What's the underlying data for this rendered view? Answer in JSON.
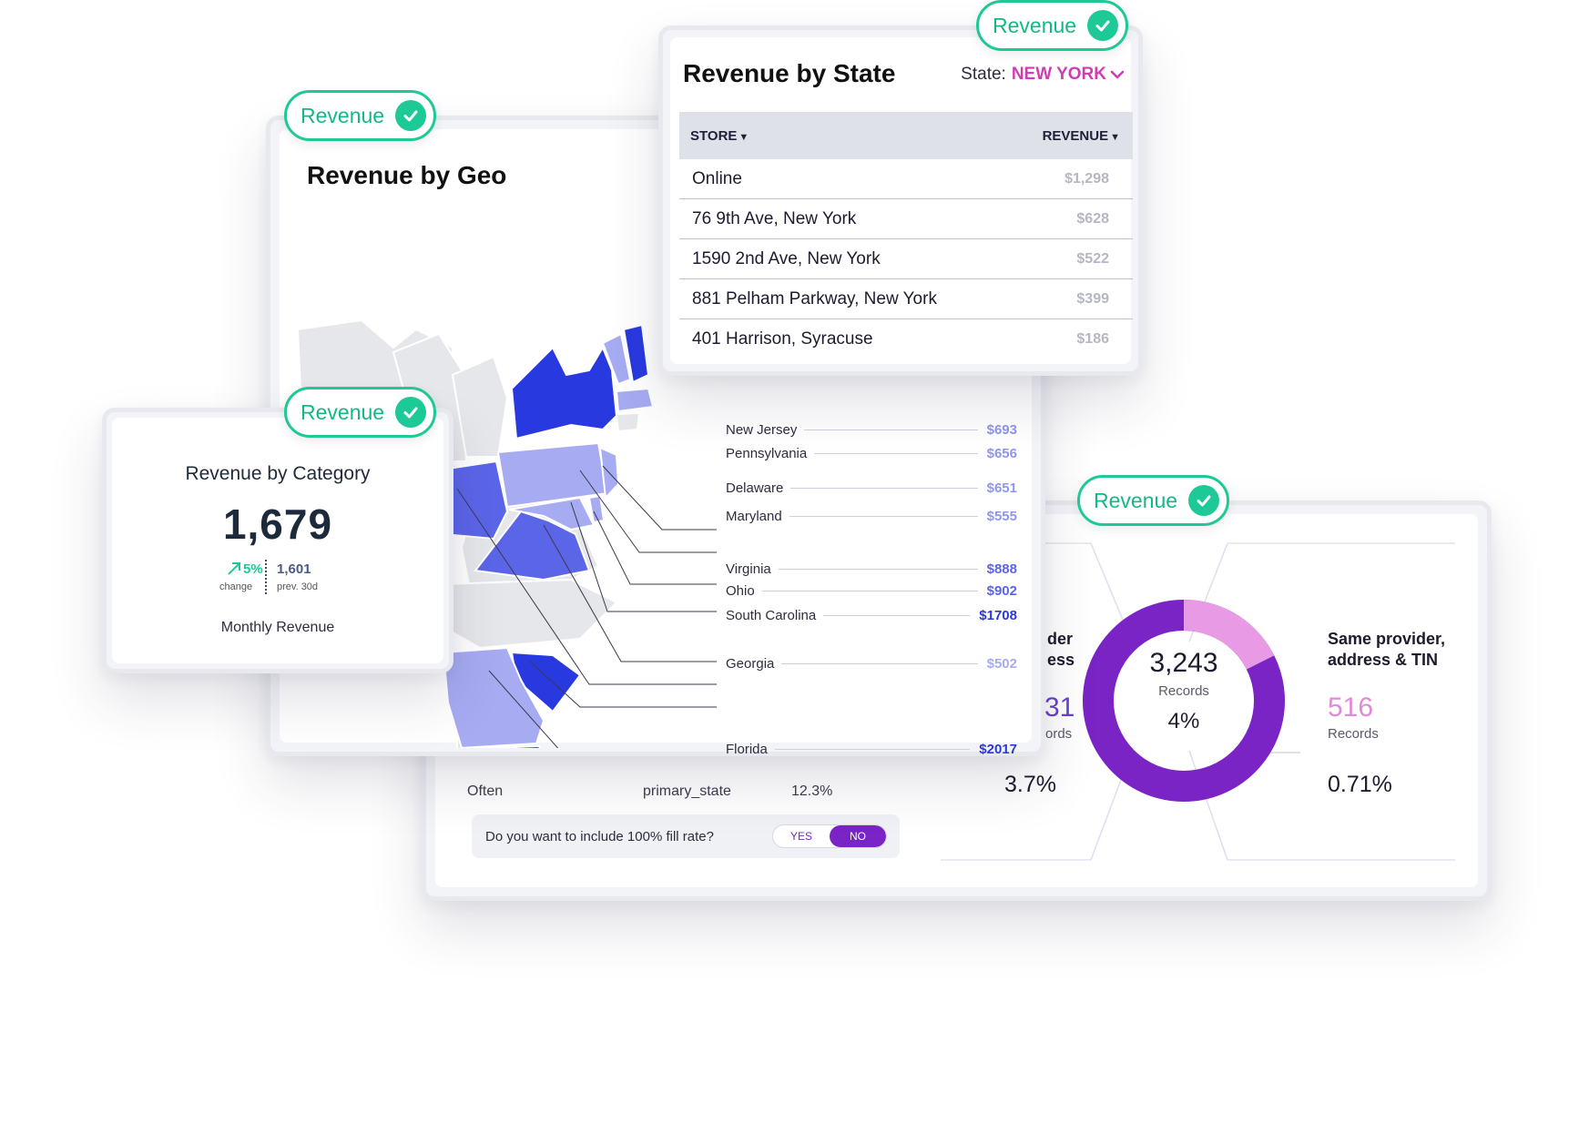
{
  "badge_label": "Revenue",
  "geo": {
    "title": "Revenue by Geo",
    "legend": [
      {
        "state": "New Jersey",
        "value": "$693",
        "color": "#8f96ee"
      },
      {
        "state": "Pennsylvania",
        "value": "$656",
        "color": "#8f96ee"
      },
      {
        "state": "Delaware",
        "value": "$651",
        "color": "#8f96ee"
      },
      {
        "state": "Maryland",
        "value": "$555",
        "color": "#8f96ee"
      },
      {
        "state": "Virginia",
        "value": "$888",
        "color": "#5b65e8"
      },
      {
        "state": "Ohio",
        "value": "$902",
        "color": "#5b65e8"
      },
      {
        "state": "South Carolina",
        "value": "$1708",
        "color": "#2939e0"
      },
      {
        "state": "Georgia",
        "value": "$502",
        "color": "#a6abf2"
      },
      {
        "state": "Florida",
        "value": "$2017",
        "color": "#2939e0"
      }
    ]
  },
  "state_table": {
    "title": "Revenue by State",
    "picker_label": "State:",
    "picker_value": "NEW YORK",
    "col_store": "STORE",
    "col_revenue": "REVENUE",
    "rows": [
      {
        "store": "Online",
        "revenue": "$1,298"
      },
      {
        "store": "76 9th Ave, New York",
        "revenue": "$628"
      },
      {
        "store": "1590 2nd Ave, New York",
        "revenue": "$522"
      },
      {
        "store": "881 Pelham Parkway, New York",
        "revenue": "$399"
      },
      {
        "store": "401 Harrison, Syracuse",
        "revenue": "$186"
      }
    ]
  },
  "category": {
    "title": "Revenue by Category",
    "value": "1,679",
    "change": "5%",
    "change_label": "change",
    "prev": "1,601",
    "prev_label": "prev. 30d",
    "subtitle": "Monthly Revenue"
  },
  "records": {
    "row_label": "Often",
    "row_field": "primary_state",
    "row_pct": "12.3%",
    "partial_title_1": "der",
    "partial_title_2": "ess",
    "partial_num": "31",
    "partial_sub": "ords",
    "partial_pct": "3.7%",
    "donut_value": "3,243",
    "donut_label": "Records",
    "donut_pct": "4%",
    "right_title_1": "Same provider,",
    "right_title_2": "address & TIN",
    "right_num": "516",
    "right_label": "Records",
    "right_pct": "0.71%",
    "question": "Do you want to include 100% fill rate?",
    "yes": "YES",
    "no": "NO"
  },
  "colors": {
    "accent_green": "#1ec998",
    "accent_pink": "#d13bb3",
    "donut_primary": "#7a24c6",
    "donut_secondary": "#e99ae4"
  }
}
